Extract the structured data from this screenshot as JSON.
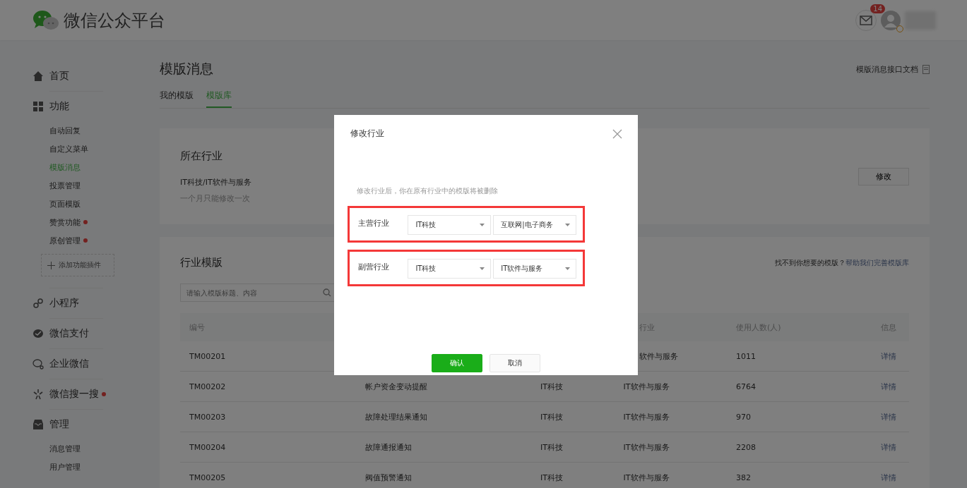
{
  "header": {
    "logo_text": "微信公众平台",
    "mail_badge": "14"
  },
  "sidebar": {
    "groups": [
      {
        "label": "首页",
        "dot": false
      },
      {
        "label": "功能",
        "dot": false,
        "items": [
          {
            "label": "自动回复",
            "selected": false,
            "dot": false
          },
          {
            "label": "自定义菜单",
            "selected": false,
            "dot": false
          },
          {
            "label": "模版消息",
            "selected": true,
            "dot": false
          },
          {
            "label": "投票管理",
            "selected": false,
            "dot": false
          },
          {
            "label": "页面模版",
            "selected": false,
            "dot": false
          },
          {
            "label": "赞赏功能",
            "selected": false,
            "dot": true
          },
          {
            "label": "原创管理",
            "selected": false,
            "dot": true
          }
        ],
        "add_button": "添加功能插件"
      },
      {
        "label": "小程序",
        "dot": false
      },
      {
        "label": "微信支付",
        "dot": false
      },
      {
        "label": "企业微信",
        "dot": false
      },
      {
        "label": "微信搜一搜",
        "dot": true
      },
      {
        "label": "管理",
        "dot": false,
        "items": [
          {
            "label": "消息管理",
            "selected": false,
            "dot": false
          },
          {
            "label": "用户管理",
            "selected": false,
            "dot": false
          }
        ]
      }
    ]
  },
  "page": {
    "title": "模版消息",
    "doc_link": "模版消息接口文档",
    "tabs": [
      {
        "label": "我的模版",
        "selected": false
      },
      {
        "label": "模版库",
        "selected": true
      }
    ],
    "industry_card": {
      "title": "所在行业",
      "value": "IT科技/IT软件与服务",
      "note": "一个月只能修改一次",
      "button": "修改"
    },
    "template_card": {
      "title": "行业模版",
      "help_text": "找不到你想要的模版？",
      "help_link": "帮助我们完善模版库",
      "search": {
        "placeholder": "请输入模版标题、内容"
      },
      "table": {
        "headers": {
          "id": "编号",
          "column_4": "行业",
          "users": "使用人数(人)",
          "info": "信息"
        },
        "rows": [
          {
            "id": "TM00201",
            "sub_industry": "软件与服务",
            "users": "1011",
            "info": "详情"
          },
          {
            "id": "TM00202",
            "title": "帐户资金变动提醒",
            "industry": "IT科技",
            "sub_industry": "IT软件与服务",
            "users": "6764",
            "info": "详情"
          },
          {
            "id": "TM00203",
            "title": "故障处理结果通知",
            "industry": "IT科技",
            "sub_industry": "IT软件与服务",
            "users": "970",
            "info": "详情"
          },
          {
            "id": "TM00204",
            "title": "故障通报通知",
            "industry": "IT科技",
            "sub_industry": "IT软件与服务",
            "users": "2208",
            "info": "详情"
          },
          {
            "id": "TM00205",
            "title": "阀值预警通知",
            "industry": "IT科技",
            "sub_industry": "IT软件与服务",
            "users": "382",
            "info": "详情"
          }
        ]
      }
    }
  },
  "modal": {
    "title": "修改行业",
    "warning": "修改行业后，你在原有行业中的模版将被删除",
    "rows": [
      {
        "label": "主营行业",
        "highlighted": true,
        "selects": [
          "IT科技",
          "互联网|电子商务"
        ]
      },
      {
        "label": "副营行业",
        "highlighted": true,
        "selects": [
          "IT科技",
          "IT软件与服务"
        ]
      }
    ],
    "buttons": [
      {
        "label": "确认",
        "kind": "primary"
      },
      {
        "label": "取消",
        "kind": "default"
      }
    ]
  }
}
